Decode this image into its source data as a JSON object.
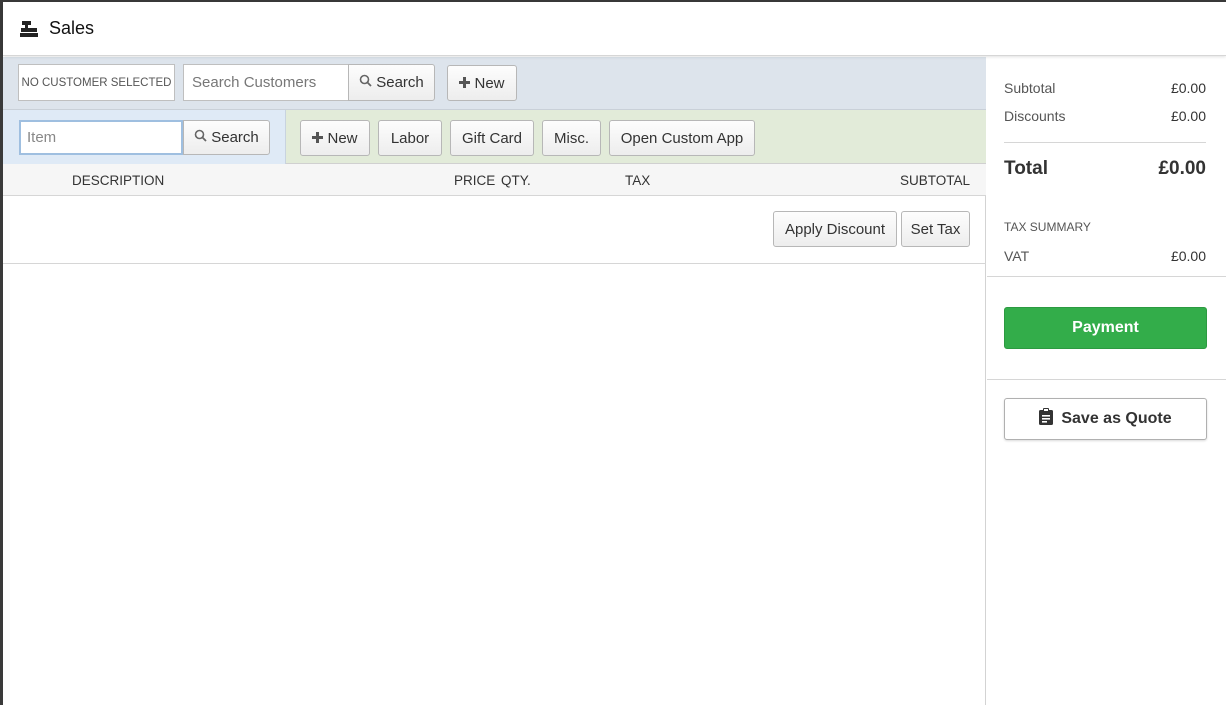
{
  "header": {
    "title": "Sales",
    "icon": "register-icon"
  },
  "customer": {
    "no_customer_label": "NO CUSTOMER SELECTED",
    "search_placeholder": "Search Customers",
    "search_label": "Search",
    "new_label": "New"
  },
  "item": {
    "search_placeholder": "Item",
    "search_label": "Search",
    "buttons": {
      "new": "New",
      "labor": "Labor",
      "gift_card": "Gift Card",
      "misc": "Misc.",
      "custom_app": "Open Custom App"
    }
  },
  "table": {
    "columns": {
      "description": "DESCRIPTION",
      "price": "PRICE",
      "qty": "QTY.",
      "tax": "TAX",
      "subtotal": "SUBTOTAL"
    }
  },
  "actions": {
    "apply_discount": "Apply Discount",
    "set_tax": "Set Tax"
  },
  "summary": {
    "subtotal_label": "Subtotal",
    "subtotal_value": "£0.00",
    "discounts_label": "Discounts",
    "discounts_value": "£0.00",
    "total_label": "Total",
    "total_value": "£0.00",
    "tax_summary_label": "TAX SUMMARY",
    "vat_label": "VAT",
    "vat_value": "£0.00"
  },
  "payment_label": "Payment",
  "quote_label": "Save as Quote",
  "colors": {
    "payment_green": "#33ad4a",
    "customer_bar": "#dde4ec",
    "item_bar": "#e2ebd9",
    "item_search_bg": "#dfeaf6"
  }
}
